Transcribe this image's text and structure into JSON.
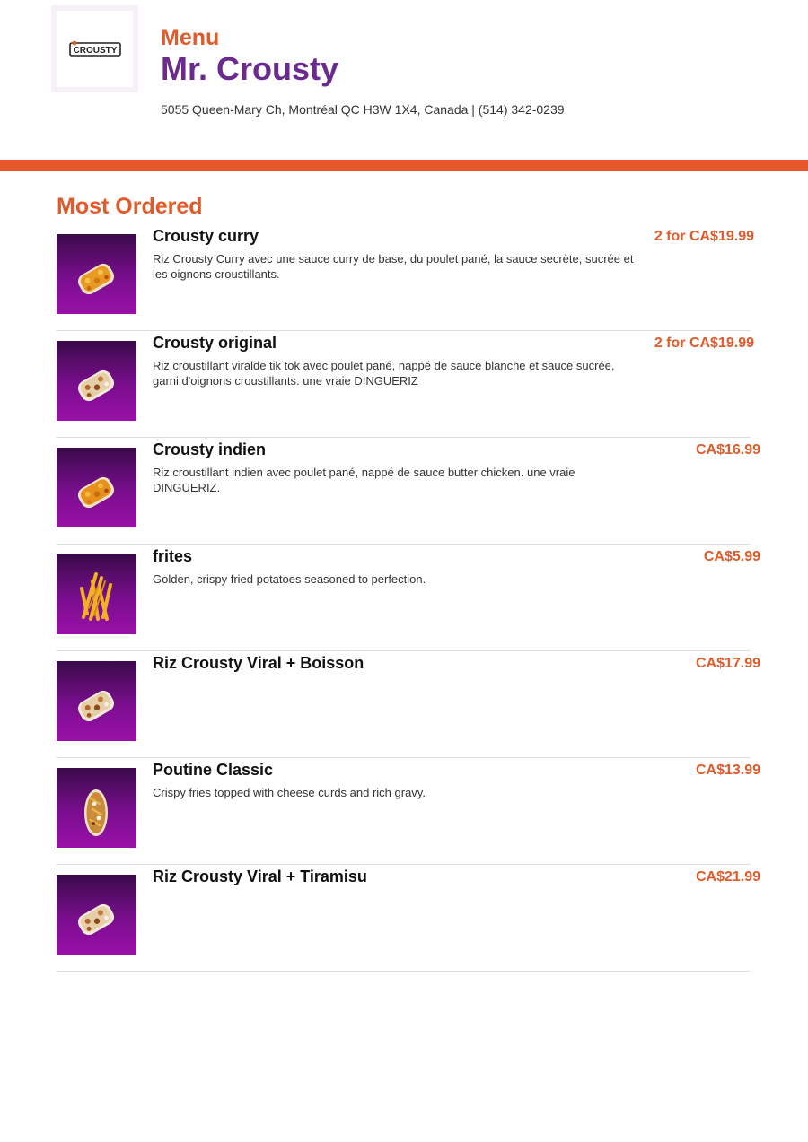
{
  "header": {
    "logo_text": "CROUSTY",
    "menu_label": "Menu",
    "restaurant_name": "Mr. Crousty",
    "address": "5055 Queen-Mary Ch, Montréal QC H3W 1X4, Canada | (514) 342-0239"
  },
  "colors": {
    "accent_orange": "#e8572a",
    "brand_purple": "#6b2a8f",
    "thumb_purple": "#7a0e8e"
  },
  "section": {
    "title": "Most Ordered"
  },
  "items": [
    {
      "name": "Crousty curry",
      "description": "Riz Crousty Curry avec une sauce curry de base, du poulet pané, la sauce secrète, sucrée et les oignons croustillants.",
      "price": "2 for CA$19.99",
      "image_icon": "rice-bowl-curry-icon"
    },
    {
      "name": "Crousty original",
      "description": "Riz croustillant viralde tik tok avec poulet pané, nappé de sauce blanche et sauce sucrée, garni d'oignons croustillants. une vraie DINGUERIZ",
      "price": "2 for CA$19.99",
      "image_icon": "rice-bowl-original-icon"
    },
    {
      "name": "Crousty indien",
      "description": "Riz croustillant indien avec poulet pané, nappé de sauce butter chicken. une vraie DINGUERIZ.",
      "price": "CA$16.99",
      "image_icon": "rice-bowl-curry-icon"
    },
    {
      "name": "frites",
      "description": "Golden, crispy fried potatoes seasoned to perfection.",
      "price": "CA$5.99",
      "image_icon": "fries-icon"
    },
    {
      "name": "Riz Crousty Viral + Boisson",
      "description": "",
      "price": "CA$17.99",
      "image_icon": "rice-bowl-original-icon"
    },
    {
      "name": "Poutine Classic",
      "description": "Crispy fries topped with cheese curds and rich gravy.",
      "price": "CA$13.99",
      "image_icon": "poutine-icon"
    },
    {
      "name": "Riz Crousty Viral + Tiramisu",
      "description": "",
      "price": "CA$21.99",
      "image_icon": "rice-bowl-original-icon"
    }
  ]
}
